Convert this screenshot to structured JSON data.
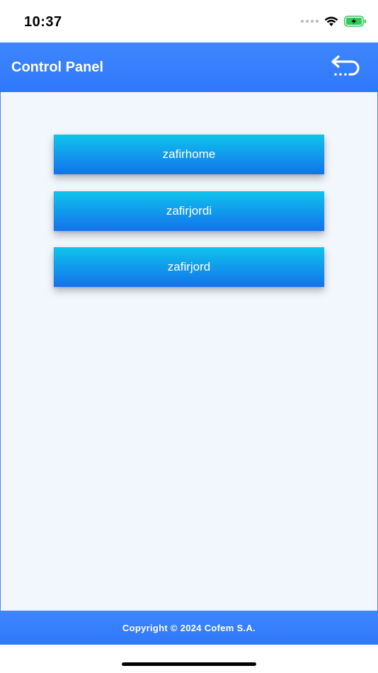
{
  "status_bar": {
    "time": "10:37",
    "icons": [
      "cellular-signal-icon",
      "wifi-icon",
      "battery-charging-icon"
    ],
    "battery_color": "#34c759"
  },
  "header": {
    "title": "Control Panel",
    "back_icon": "back-arrow-icon",
    "color": "#2f7cff"
  },
  "devices": [
    {
      "label": "zafirhome"
    },
    {
      "label": "zafirjordi"
    },
    {
      "label": "zafirjord"
    }
  ],
  "footer": {
    "copyright": "Copyright © 2024 Cofem S.A."
  }
}
